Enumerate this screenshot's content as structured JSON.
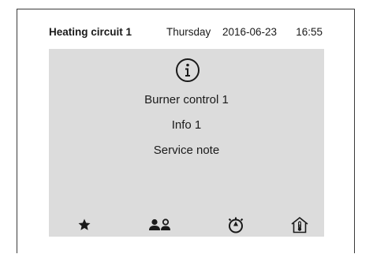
{
  "header": {
    "circuit": "Heating circuit 1",
    "day": "Thursday",
    "date": "2016-06-23",
    "time": "16:55"
  },
  "message": {
    "icon": "info-icon",
    "line1": "Burner control 1",
    "line2": "Info 1",
    "line3": "Service note"
  },
  "toolbar": {
    "buttons": [
      {
        "icon": "star-icon"
      },
      {
        "icon": "users-icon"
      },
      {
        "icon": "timer-icon"
      },
      {
        "icon": "home-thermometer-icon"
      }
    ]
  },
  "colors": {
    "panel": "#dcdcdc",
    "text": "#1a1a1a"
  }
}
